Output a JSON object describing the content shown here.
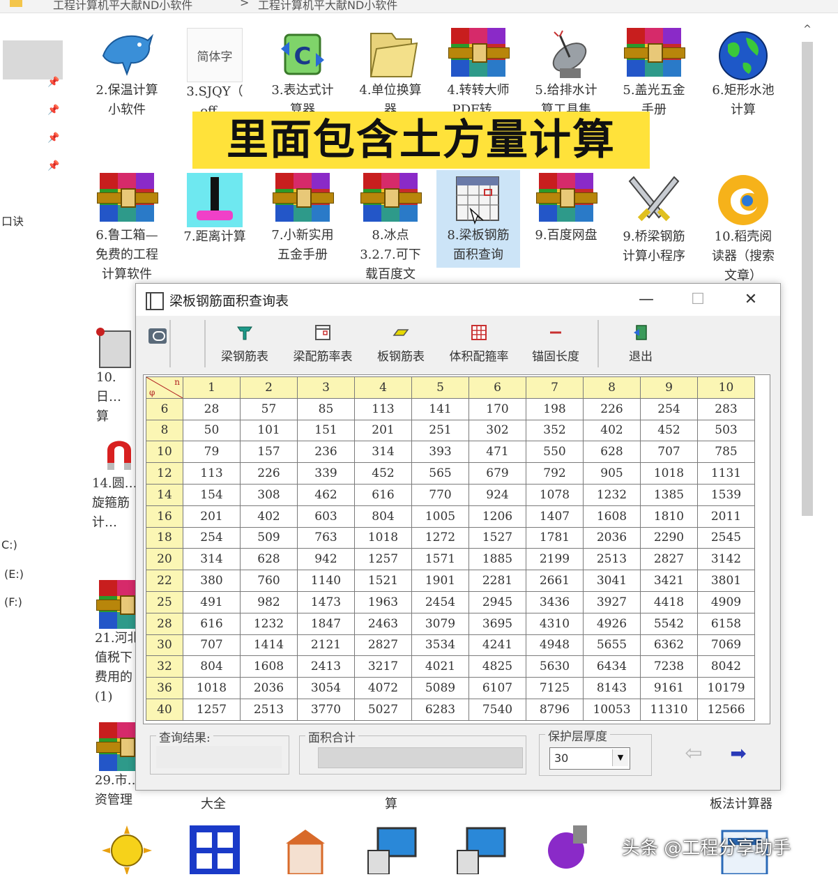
{
  "address_bar": {
    "seg1": "工程计算机平大献ND小软件",
    "seg2": "工程计算机平大献ND小软件",
    "sep": ">"
  },
  "nav_pane": {
    "items": [
      "口诀",
      "C:)",
      "(E:)",
      "(F:)"
    ]
  },
  "banner": {
    "text": "里面包含土方量计算"
  },
  "icons_row1": [
    {
      "label": "2.保温计算\n小软件",
      "icon": "dolphin-icon"
    },
    {
      "label": "3.SJQY（\noff…",
      "icon": "font-doc-icon",
      "icon_text": "简体字"
    },
    {
      "label": "3.表达式计\n算器",
      "icon": "c-refresh-icon"
    },
    {
      "label": "4.单位换算\n器",
      "icon": "folder-icon"
    },
    {
      "label": "4.转转大师\nPDF转…",
      "icon": "winrar-icon"
    },
    {
      "label": "5.给排水计\n算工具集",
      "icon": "satellite-icon"
    },
    {
      "label": "5.盖光五金\n手册",
      "icon": "winrar-icon"
    },
    {
      "label": "6.矩形水池\n计算",
      "icon": "globe-icon"
    }
  ],
  "icons_row2": [
    {
      "label": "6.鲁工箱—\n免费的工程\n计算软件",
      "icon": "winrar-icon"
    },
    {
      "label": "7.距离计算",
      "icon": "distance-icon"
    },
    {
      "label": "7.小新实用\n五金手册",
      "icon": "winrar-icon"
    },
    {
      "label": "8.冰点\n3.2.7.可下\n载百度文",
      "icon": "winrar-icon"
    },
    {
      "label": "8.梁板钢筋\n面积查询",
      "icon": "table-app-icon",
      "selected": true
    },
    {
      "label": "9.百度网盘",
      "icon": "winrar-icon"
    },
    {
      "label": "9.桥梁钢筋\n计算小程序",
      "icon": "swords-icon"
    },
    {
      "label": "10.稻壳阅\n读器（搜索\n文章）",
      "icon": "docer-icon"
    }
  ],
  "left_partial_labels": [
    "10.日…\n算",
    "14.圆…\n旋箍筋\n计…",
    "21.河北\n值税下\n费用的\n(1)",
    "29.市…\n资管理"
  ],
  "bottom_partial_labels": [
    "大全",
    "算",
    "板法计算器"
  ],
  "dialog": {
    "title": "梁板钢筋面积查询表",
    "controls": {
      "minimize": "—",
      "maximize": "☐",
      "close": "✕"
    },
    "toolbar": [
      {
        "label": "梁钢筋表",
        "icon": "beam-icon",
        "color": "#1e9a8a"
      },
      {
        "label": "梁配筋率表",
        "icon": "window-icon",
        "color": "#555555"
      },
      {
        "label": "板钢筋表",
        "icon": "slab-icon",
        "color": "#d8c800"
      },
      {
        "label": "体积配箍率",
        "icon": "grid-icon",
        "color": "#c83030"
      },
      {
        "label": "锚固长度",
        "icon": "anchor-line-icon",
        "color": "#c83030"
      },
      {
        "label": "退出",
        "icon": "exit-door-icon",
        "color": "#2a8a4a"
      }
    ],
    "table": {
      "corner_top": "n",
      "corner_bottom": "φ",
      "columns": [
        "1",
        "2",
        "3",
        "4",
        "5",
        "6",
        "7",
        "8",
        "9",
        "10"
      ],
      "rows": [
        {
          "d": "6",
          "v": [
            "28",
            "57",
            "85",
            "113",
            "141",
            "170",
            "198",
            "226",
            "254",
            "283"
          ]
        },
        {
          "d": "8",
          "v": [
            "50",
            "101",
            "151",
            "201",
            "251",
            "302",
            "352",
            "402",
            "452",
            "503"
          ]
        },
        {
          "d": "10",
          "v": [
            "79",
            "157",
            "236",
            "314",
            "393",
            "471",
            "550",
            "628",
            "707",
            "785"
          ]
        },
        {
          "d": "12",
          "v": [
            "113",
            "226",
            "339",
            "452",
            "565",
            "679",
            "792",
            "905",
            "1018",
            "1131"
          ]
        },
        {
          "d": "14",
          "v": [
            "154",
            "308",
            "462",
            "616",
            "770",
            "924",
            "1078",
            "1232",
            "1385",
            "1539"
          ]
        },
        {
          "d": "16",
          "v": [
            "201",
            "402",
            "603",
            "804",
            "1005",
            "1206",
            "1407",
            "1608",
            "1810",
            "2011"
          ]
        },
        {
          "d": "18",
          "v": [
            "254",
            "509",
            "763",
            "1018",
            "1272",
            "1527",
            "1781",
            "2036",
            "2290",
            "2545"
          ]
        },
        {
          "d": "20",
          "v": [
            "314",
            "628",
            "942",
            "1257",
            "1571",
            "1885",
            "2199",
            "2513",
            "2827",
            "3142"
          ]
        },
        {
          "d": "22",
          "v": [
            "380",
            "760",
            "1140",
            "1521",
            "1901",
            "2281",
            "2661",
            "3041",
            "3421",
            "3801"
          ]
        },
        {
          "d": "25",
          "v": [
            "491",
            "982",
            "1473",
            "1963",
            "2454",
            "2945",
            "3436",
            "3927",
            "4418",
            "4909"
          ]
        },
        {
          "d": "28",
          "v": [
            "616",
            "1232",
            "1847",
            "2463",
            "3079",
            "3695",
            "4310",
            "4926",
            "5542",
            "6158"
          ]
        },
        {
          "d": "30",
          "v": [
            "707",
            "1414",
            "2121",
            "2827",
            "3534",
            "4241",
            "4948",
            "5655",
            "6362",
            "7069"
          ]
        },
        {
          "d": "32",
          "v": [
            "804",
            "1608",
            "2413",
            "3217",
            "4021",
            "4825",
            "5630",
            "6434",
            "7238",
            "8042"
          ]
        },
        {
          "d": "36",
          "v": [
            "1018",
            "2036",
            "3054",
            "4072",
            "5089",
            "6107",
            "7125",
            "8143",
            "9161",
            "10179"
          ]
        },
        {
          "d": "40",
          "v": [
            "1257",
            "2513",
            "3770",
            "5027",
            "6283",
            "7540",
            "8796",
            "10053",
            "11310",
            "12566"
          ]
        }
      ]
    },
    "bottom": {
      "query_result_label": "查询结果:",
      "area_total_label": "面积合计",
      "cover_label": "保护层厚度",
      "cover_value": "30",
      "dropdown_arrow": "▼",
      "prev_arrow": "⇦",
      "next_arrow": "➡"
    }
  },
  "watermark": "头条 @工程分享助手",
  "scroll_up": "^",
  "colors": {
    "banner": "#ffe23a",
    "header_fill": "#fbf6b4",
    "selection": "#cce4f7"
  }
}
